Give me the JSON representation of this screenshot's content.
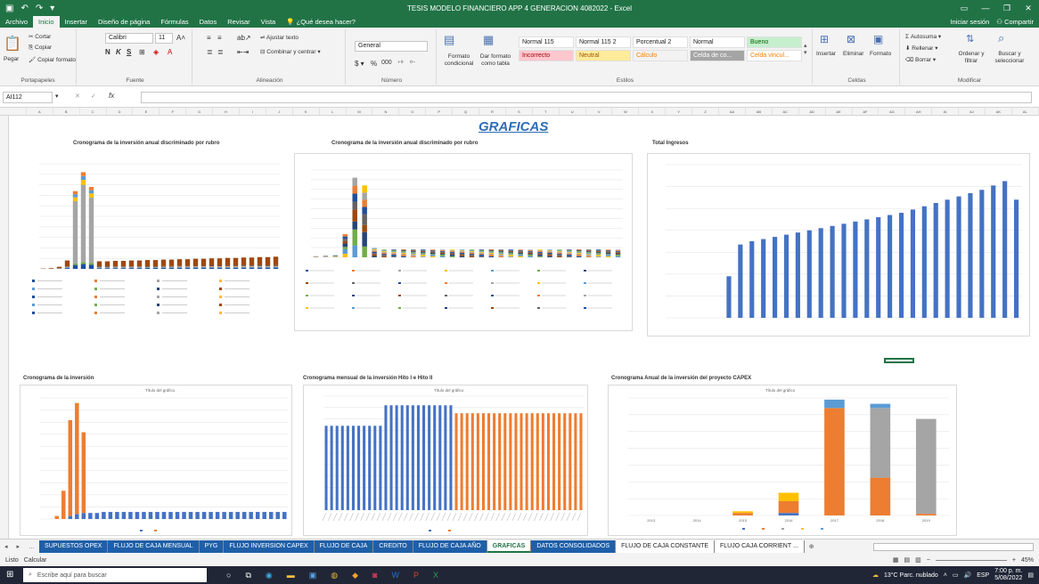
{
  "window": {
    "title": "TESIS MODELO FINANCIERO APP 4 GENERACION 4082022 - Excel",
    "sign_in": "Iniciar sesión",
    "share": "Compartir"
  },
  "ribbon_tabs": [
    "Archivo",
    "Inicio",
    "Insertar",
    "Diseño de página",
    "Fórmulas",
    "Datos",
    "Revisar",
    "Vista",
    "¿Qué desea hacer?"
  ],
  "ribbon": {
    "clipboard": {
      "cut": "Cortar",
      "copy": "Copiar",
      "paste": "Pegar",
      "format_painter": "Copiar formato",
      "label": "Portapapeles"
    },
    "font": {
      "name": "Calibri",
      "size": "11",
      "label": "Fuente",
      "bold": "N",
      "italic": "K",
      "underline": "S"
    },
    "alignment": {
      "wrap": "Ajustar texto",
      "merge": "Combinar y centrar",
      "label": "Alineación"
    },
    "number": {
      "format": "General",
      "currency": "$",
      "percent": "%",
      "thousands": "000",
      "label": "Número"
    },
    "styles": {
      "cond_format": "Formato condicional",
      "as_table": "Dar formato como tabla",
      "label": "Estilos",
      "cells": [
        {
          "name": "Normal 115",
          "bg": "#ffffff",
          "fg": "#222222"
        },
        {
          "name": "Normal 115 2",
          "bg": "#ffffff",
          "fg": "#222222"
        },
        {
          "name": "Porcentual 2",
          "bg": "#ffffff",
          "fg": "#222222"
        },
        {
          "name": "Normal",
          "bg": "#ffffff",
          "fg": "#222222"
        },
        {
          "name": "Bueno",
          "bg": "#c6efce",
          "fg": "#006100"
        },
        {
          "name": "Incorrecto",
          "bg": "#ffc7ce",
          "fg": "#9c0006"
        },
        {
          "name": "Neutral",
          "bg": "#ffeb9c",
          "fg": "#9c5700"
        },
        {
          "name": "Cálculo",
          "bg": "#f2f2f2",
          "fg": "#fa7d00"
        },
        {
          "name": "Celda de co...",
          "bg": "#a5a5a5",
          "fg": "#ffffff"
        },
        {
          "name": "Celda vincul...",
          "bg": "#ffffff",
          "fg": "#fa7d00"
        }
      ]
    },
    "cells": {
      "insert": "Insertar",
      "delete": "Eliminar",
      "format": "Formato",
      "label": "Celdas"
    },
    "edit": {
      "autosum": "Autosuma",
      "fill": "Rellenar",
      "clear": "Borrar",
      "sort": "Ordenar y filtrar",
      "find": "Buscar y seleccionar",
      "label": "Modificar"
    }
  },
  "formula_bar": {
    "name_box": "AI112",
    "fx": "fx",
    "formula": ""
  },
  "sheet": {
    "title": "GRAFICAS"
  },
  "chart_data": [
    {
      "type": "bar",
      "title": "Cronograma de la inversión anual discriminado por rubro",
      "stacked": true,
      "series_colors": [
        "#1f4e9c",
        "#ed7d31",
        "#a5a5a5",
        "#ffc000",
        "#5b9bd5",
        "#70ad47",
        "#264478",
        "#9e480e"
      ],
      "totals": [
        1,
        2,
        5,
        20,
        185,
        230,
        195,
        18,
        18,
        19,
        19,
        20,
        20,
        21,
        21,
        22,
        22,
        23,
        23,
        24,
        24,
        25,
        25,
        26,
        26,
        27,
        27,
        28,
        28,
        29
      ]
    },
    {
      "type": "bar",
      "title": "Cronograma de la inversión anual discriminado por rubro",
      "stacked": true,
      "totals": [
        2,
        3,
        4,
        45,
        155,
        140,
        18,
        15,
        15,
        15,
        15,
        15,
        15,
        15,
        15,
        15,
        15,
        15,
        15,
        15,
        15,
        15,
        15,
        15,
        15,
        15,
        15,
        15,
        15,
        15,
        15,
        15
      ]
    },
    {
      "type": "bar",
      "title": "Total Ingresos",
      "values": [
        0,
        0,
        0,
        0,
        0,
        38,
        67,
        70,
        72,
        74,
        76,
        78,
        80,
        82,
        84,
        86,
        88,
        90,
        92,
        94,
        96,
        99,
        102,
        105,
        108,
        111,
        114,
        117,
        121,
        125,
        108
      ]
    },
    {
      "type": "bar",
      "title": "Cronograma de la inversión",
      "subtitle": "Título del gráfico",
      "stacked": true,
      "blue": [
        0,
        0,
        0,
        0,
        3,
        5,
        6,
        6,
        6,
        7,
        7,
        7,
        7,
        7,
        7,
        7,
        7,
        7,
        7,
        7,
        7,
        7,
        7,
        7,
        7,
        7,
        7,
        7,
        7,
        7,
        7,
        7,
        7,
        7,
        7,
        7,
        7
      ],
      "orange": [
        0,
        0,
        3,
        28,
        95,
        110,
        80,
        0,
        0,
        0,
        0,
        0,
        0,
        0,
        0,
        0,
        0,
        0,
        0,
        0,
        0,
        0,
        0,
        0,
        0,
        0,
        0,
        0,
        0,
        0,
        0,
        0,
        0,
        0,
        0,
        0,
        0
      ]
    },
    {
      "type": "bar",
      "title": "Cronograma mensual de la inversión Hito I e Hito II",
      "subtitle": "Título del gráfico",
      "blue": [
        74,
        74,
        74,
        74,
        74,
        74,
        74,
        74,
        74,
        74,
        74,
        92,
        92,
        92,
        92,
        92,
        92,
        92,
        92,
        92,
        92,
        92,
        92,
        92
      ],
      "orange": [
        85,
        85,
        85,
        85,
        85,
        85,
        85,
        85,
        85,
        85,
        85,
        85,
        85,
        85,
        85,
        85,
        85,
        85,
        85,
        85,
        85,
        85,
        85,
        85
      ]
    },
    {
      "type": "bar",
      "title": "Cronograma Anual de la inversión del proyecto CAPEX",
      "subtitle": "Título del gráfico",
      "stacked": true,
      "categories": [
        "2013",
        "2014",
        "2015",
        "2016",
        "2017",
        "2018",
        "2019"
      ],
      "stacks": [
        {
          "blue": 0,
          "orange": 0,
          "gray": 0,
          "yellow": 0,
          "lightblue": 0
        },
        {
          "blue": 0,
          "orange": 0,
          "gray": 0,
          "yellow": 0,
          "lightblue": 0
        },
        {
          "blue": 0,
          "orange": 3,
          "gray": 0,
          "yellow": 2,
          "lightblue": 0
        },
        {
          "blue": 3,
          "orange": 14,
          "gray": 0,
          "yellow": 10,
          "lightblue": 0
        },
        {
          "blue": 0,
          "orange": 128,
          "gray": 0,
          "yellow": 0,
          "lightblue": 10
        },
        {
          "blue": 0,
          "orange": 45,
          "gray": 83,
          "yellow": 0,
          "lightblue": 5
        },
        {
          "blue": 0,
          "orange": 2,
          "gray": 113,
          "yellow": 0,
          "lightblue": 0
        }
      ]
    }
  ],
  "sheet_tabs": [
    {
      "label": "SUPUESTOS OPEX",
      "state": "dark"
    },
    {
      "label": "FLUJO DE CAJA MENSUAL",
      "state": "dark"
    },
    {
      "label": "PYG",
      "state": "dark"
    },
    {
      "label": "FLUJO INVERSION CAPEX",
      "state": "dark"
    },
    {
      "label": "FLUJO DE CAJA",
      "state": "dark"
    },
    {
      "label": "CREDITO",
      "state": "dark"
    },
    {
      "label": "FLUJO DE CAJA AÑO",
      "state": "dark"
    },
    {
      "label": "GRAFICAS",
      "state": "active"
    },
    {
      "label": "DATOS CONSOLIDADOS",
      "state": "dark"
    },
    {
      "label": "FLUJO DE CAJA CONSTANTE",
      "state": "light"
    },
    {
      "label": "FLUJO CAJA CORRIENT ...",
      "state": "light"
    }
  ],
  "status": {
    "ready": "Listo",
    "calc": "Calcular",
    "zoom": "45%"
  },
  "taskbar": {
    "search": "Escribe aquí para buscar",
    "weather": "13°C Parc. nublado",
    "lang": "ESP",
    "time": "7:00 p. m.",
    "date": "5/08/2022"
  }
}
